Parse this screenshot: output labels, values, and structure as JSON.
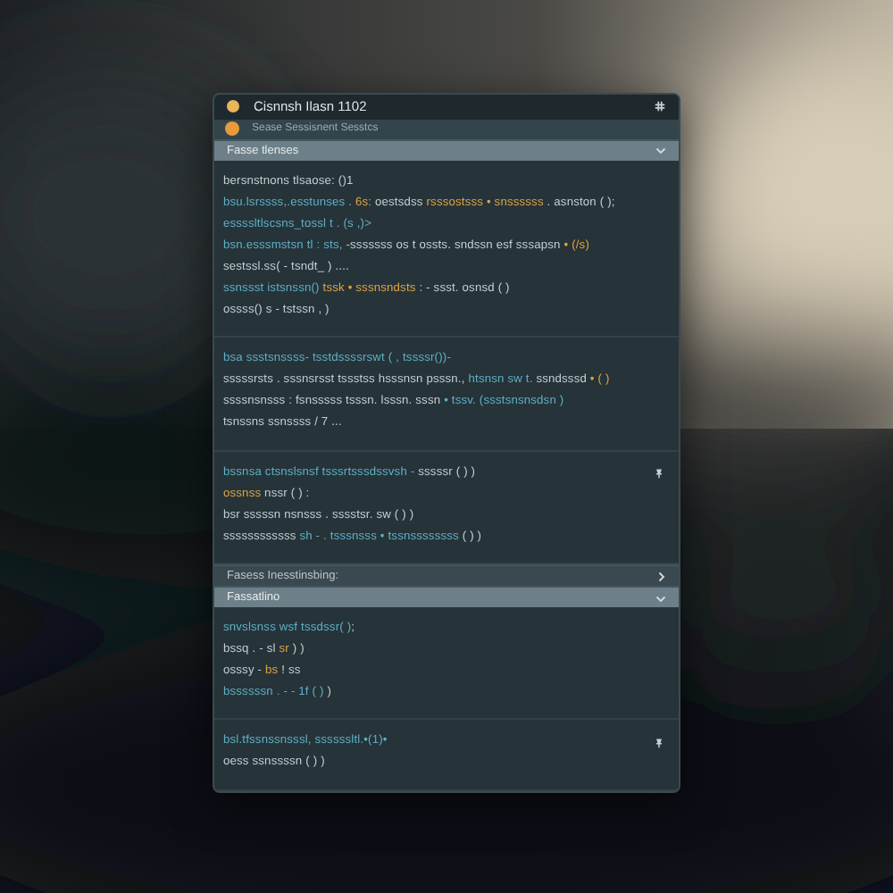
{
  "window": {
    "title": "Cisnnsh Ilasn 1102"
  },
  "subheader": {
    "text": "Sease Sessisnent Sesstcs"
  },
  "blocks": [
    {
      "kind": "header",
      "title": "Fasse tlenses",
      "expanded": true
    },
    {
      "kind": "code",
      "lines": [
        {
          "pin": false,
          "segments": [
            {
              "kind": "plain",
              "text": "bersnstnons tlsaose: ()1"
            }
          ]
        },
        {
          "pin": false,
          "segments": [
            {
              "kind": "name",
              "text": "bsu.lsrssss,.esstunses ."
            },
            {
              "kind": "literal",
              "text": " 6s: "
            },
            {
              "kind": "plain",
              "text": "oestsdss "
            },
            {
              "kind": "literal",
              "text": "rsssostsss • snssssss"
            },
            {
              "kind": "plain",
              "text": " . asnston ( );"
            }
          ]
        },
        {
          "pin": false,
          "segments": [
            {
              "kind": "name",
              "text": "essssltlscsns_tossl t . (s ,)>"
            }
          ]
        },
        {
          "pin": false,
          "segments": [
            {
              "kind": "name",
              "text": "bsn.esssmstsn tl : sts,"
            },
            {
              "kind": "plain",
              "text": " -sssssss os t ossts. sndssn esf sssapsn"
            },
            {
              "kind": "literal",
              "text": " • (/s)"
            }
          ]
        },
        {
          "pin": false,
          "segments": [
            {
              "kind": "plain",
              "text": "sestssl.ss( - tsndt_ ) ...."
            }
          ]
        },
        {
          "pin": false,
          "segments": [
            {
              "kind": "name",
              "text": "ssnssst istsnssn()"
            },
            {
              "kind": "literal",
              "text": " tssk • sssnsndsts"
            },
            {
              "kind": "plain",
              "text": " : - ssst. osnsd ( )"
            }
          ]
        },
        {
          "pin": false,
          "segments": [
            {
              "kind": "plain",
              "text": "ossss() s - tstssn , )"
            }
          ]
        }
      ]
    },
    {
      "kind": "code",
      "lines": [
        {
          "pin": false,
          "segments": [
            {
              "kind": "name",
              "text": "bsa ssstsnssss- tsstdssssrswt ( , tssssr())-"
            }
          ]
        },
        {
          "pin": false,
          "segments": [
            {
              "kind": "plain",
              "text": "sssssrsts . sssnsrsst tssstss hsssnsn psssn.,"
            },
            {
              "kind": "name",
              "text": " htsnsn sw t. "
            },
            {
              "kind": "plain",
              "text": "ssndsssd"
            },
            {
              "kind": "literal",
              "text": " • ( )"
            }
          ]
        },
        {
          "pin": false,
          "segments": [
            {
              "kind": "plain",
              "text": "ssssnsnsss : fsnsssss tsssn. lsssn. sssn "
            },
            {
              "kind": "name",
              "text": "• tssv. (ssstsnsnsdsn )"
            }
          ]
        },
        {
          "pin": false,
          "segments": [
            {
              "kind": "plain",
              "text": "tsnssns ssnssss / 7 ..."
            }
          ]
        }
      ]
    },
    {
      "kind": "code",
      "lines": [
        {
          "pin": true,
          "segments": [
            {
              "kind": "name",
              "text": "bssnsa ctsnslsnsf tsssrtsssdssvsh - "
            },
            {
              "kind": "plain",
              "text": "sssssr ( ) )"
            }
          ]
        },
        {
          "pin": false,
          "segments": [
            {
              "kind": "literal",
              "text": "ossnss"
            },
            {
              "kind": "plain",
              "text": " nssr ( ) :"
            }
          ]
        },
        {
          "pin": false,
          "segments": [
            {
              "kind": "plain",
              "text": "bsr sssssn nsnsss . sssstsr. sw ( ) )"
            }
          ]
        },
        {
          "pin": false,
          "segments": [
            {
              "kind": "plain",
              "text": "ssssssssssss "
            },
            {
              "kind": "name",
              "text": "sh - . tsssnsss • tssnssssssss"
            },
            {
              "kind": "plain",
              "text": " ( ) )"
            }
          ]
        }
      ]
    },
    {
      "kind": "header",
      "title": "Fasess Inesstinsbing:",
      "expanded": false
    },
    {
      "kind": "header",
      "title": "Fassatlino",
      "expanded": true
    },
    {
      "kind": "code",
      "lines": [
        {
          "pin": false,
          "segments": [
            {
              "kind": "name",
              "text": "snvslsnss wsf tssdssr( )"
            },
            {
              "kind": "plain",
              "text": ";"
            }
          ]
        },
        {
          "pin": false,
          "segments": [
            {
              "kind": "plain",
              "text": "bssq . - sl"
            },
            {
              "kind": "literal",
              "text": " sr"
            },
            {
              "kind": "plain",
              "text": " ) )"
            }
          ]
        },
        {
          "pin": false,
          "segments": [
            {
              "kind": "plain",
              "text": "osssy - "
            },
            {
              "kind": "literal",
              "text": "bs"
            },
            {
              "kind": "plain",
              "text": " ! ss"
            }
          ]
        },
        {
          "pin": false,
          "segments": [
            {
              "kind": "name",
              "text": "bssssssn . - - 1f ( )"
            },
            {
              "kind": "plain",
              "text": " )"
            }
          ]
        }
      ]
    },
    {
      "kind": "code",
      "lines": [
        {
          "pin": true,
          "segments": [
            {
              "kind": "name",
              "text": "bsl.tfssnssnsssl, ssssssltl.•(1)•"
            }
          ]
        },
        {
          "pin": false,
          "segments": [
            {
              "kind": "plain",
              "text": "oess ssnssssn ( ) )"
            }
          ]
        }
      ]
    }
  ]
}
